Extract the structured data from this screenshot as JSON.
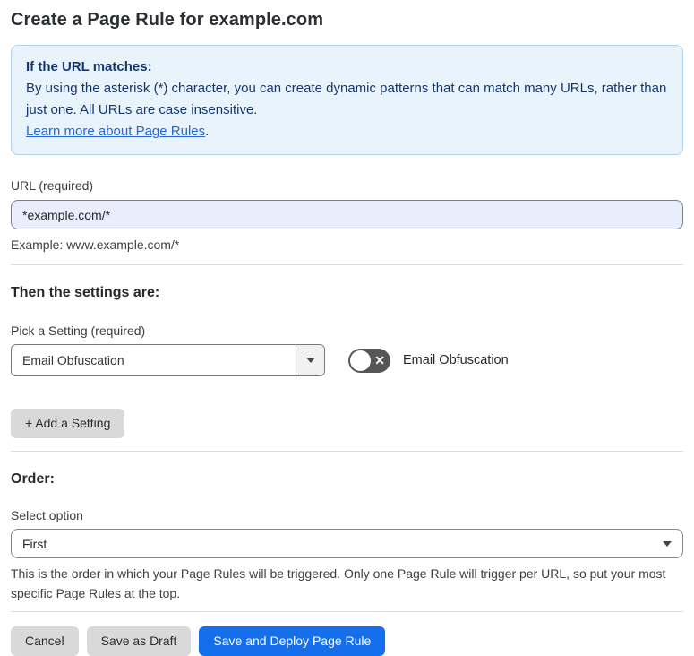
{
  "page": {
    "title": "Create a Page Rule for example.com"
  },
  "info_box": {
    "heading": "If the URL matches:",
    "body": "By using the asterisk (*) character, you can create dynamic patterns that can match many URLs, rather than just one. All URLs are case insensitive.",
    "link_label": "Learn more about Page Rules",
    "link_suffix": "."
  },
  "url_field": {
    "label": "URL (required)",
    "value": "*example.com/*",
    "helper": "Example: www.example.com/*"
  },
  "settings_section": {
    "heading": "Then the settings are:",
    "picker_label": "Pick a Setting (required)",
    "picker_value": "Email Obfuscation",
    "toggle": {
      "label": "Email Obfuscation",
      "state": "off",
      "off_glyph": "✕"
    },
    "add_button_label": "+ Add a Setting"
  },
  "order_section": {
    "heading": "Order:",
    "select_label": "Select option",
    "select_value": "First",
    "helper": "This is the order in which your Page Rules will be triggered. Only one Page Rule will trigger per URL, so put your most specific Page Rules at the top."
  },
  "footer": {
    "cancel_label": "Cancel",
    "save_draft_label": "Save as Draft",
    "save_deploy_label": "Save and Deploy Page Rule"
  },
  "colors": {
    "accent_blue": "#156fed",
    "info_box_bg": "#e9f3fc",
    "info_box_border": "#afd3ef",
    "info_text": "#16376b",
    "link_blue": "#2467d2",
    "input_bg": "#e8eefb",
    "toggle_off_bg": "#565656",
    "button_gray": "#d9d9d9"
  }
}
